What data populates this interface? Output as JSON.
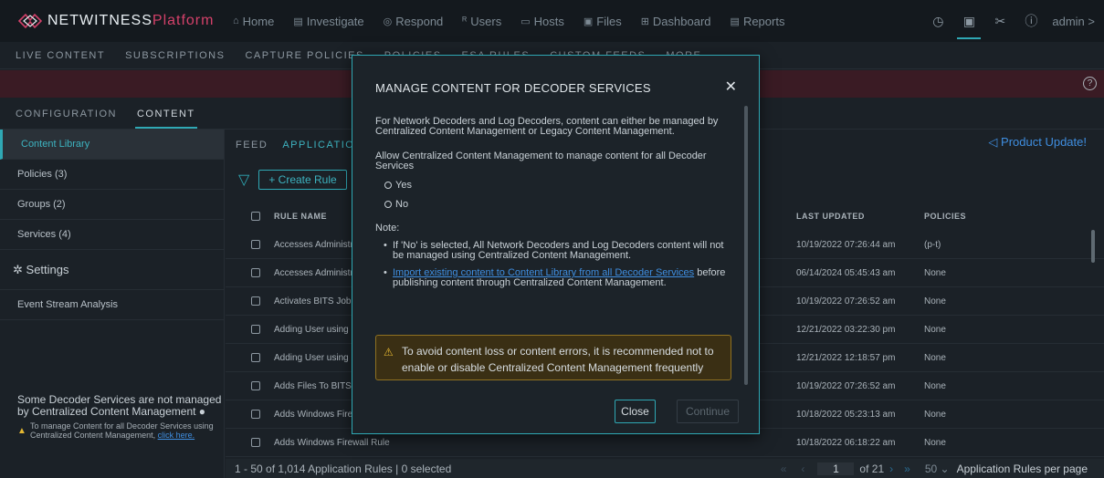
{
  "brand": {
    "name": "NETWITNESS",
    "product": "Platform"
  },
  "topnav": {
    "items": [
      {
        "icon": "home-icon",
        "glyph": "⌂",
        "label": "Home"
      },
      {
        "icon": "investigate-icon",
        "glyph": "▤",
        "label": "Investigate"
      },
      {
        "icon": "respond-icon",
        "glyph": "◎",
        "label": "Respond"
      },
      {
        "icon": "users-icon",
        "glyph": "ᴿ",
        "label": "Users"
      },
      {
        "icon": "hosts-icon",
        "glyph": "▭",
        "label": "Hosts"
      },
      {
        "icon": "files-icon",
        "glyph": "▣",
        "label": "Files"
      },
      {
        "icon": "dashboard-icon",
        "glyph": "⊞",
        "label": "Dashboard"
      },
      {
        "icon": "reports-icon",
        "glyph": "▤",
        "label": "Reports"
      }
    ],
    "user": "admin >"
  },
  "subnav": [
    "LIVE CONTENT",
    "SUBSCRIPTIONS",
    "CAPTURE POLICIES",
    "POLICIES",
    "ESA RULES",
    "CUSTOM FEEDS",
    "MORE ⌄"
  ],
  "config_tabs": [
    "CONFIGURATION",
    "CONTENT"
  ],
  "sidebar": {
    "items": [
      "Content Library",
      "Policies (3)",
      "Groups (2)",
      "Services (4)"
    ],
    "settings": "Settings",
    "event_stream": "Event Stream Analysis",
    "notice_title": "Some Decoder Services are not managed by Centralized Content Management",
    "notice_text": "To manage Content for all Decoder Services using Centralized Content Management,",
    "notice_link": "click here."
  },
  "main": {
    "tabs": [
      "FEED",
      "APPLICATION RULES"
    ],
    "product_update": "Product Update!",
    "create_label": "Create Rule",
    "columns": {
      "name": "RULE NAME",
      "updated": "LAST UPDATED",
      "policies": "POLICIES"
    },
    "rows": [
      {
        "name": "Accesses Administrative Share",
        "updated": "10/19/2022 07:26:44 am",
        "policies": "(p-t)"
      },
      {
        "name": "Accesses Administrative Share",
        "updated": "06/14/2024 05:45:43 am",
        "policies": "None"
      },
      {
        "name": "Activates BITS Job",
        "updated": "10/19/2022 07:26:52 am",
        "policies": "None"
      },
      {
        "name": "Adding User using Net",
        "updated": "12/21/2022 03:22:30 pm",
        "policies": "None"
      },
      {
        "name": "Adding User using Net",
        "updated": "12/21/2022 12:18:57 pm",
        "policies": "None"
      },
      {
        "name": "Adds Files To BITS Job",
        "updated": "10/19/2022 07:26:52 am",
        "policies": "None"
      },
      {
        "name": "Adds Windows Firewall Rule",
        "updated": "10/18/2022 05:23:13 am",
        "policies": "None"
      },
      {
        "name": "Adds Windows Firewall Rule",
        "updated": "10/18/2022 06:18:22 am",
        "policies": "None"
      }
    ],
    "footer": "1 - 50 of 1,014 Application Rules | 0 selected",
    "pager": {
      "page": "1",
      "of": "of 21",
      "per_page": "50",
      "per_page_label": "Application Rules per page"
    }
  },
  "modal": {
    "title": "MANAGE CONTENT FOR DECODER SERVICES",
    "intro": "For Network Decoders and Log Decoders, content can either be managed by Centralized Content Management or Legacy Content Management.",
    "question": "Allow Centralized Content Management to manage content for all Decoder Services",
    "options": [
      "Yes",
      "No"
    ],
    "note_label": "Note:",
    "note1": "If 'No' is selected, All Network Decoders and Log Decoders content will not be managed using Centralized Content Management.",
    "note2_link": "Import existing content to Content Library from all Decoder Services",
    "note2_rest": " before publishing content through Centralized Content Management.",
    "warning": "To avoid content loss or content errors, it is recommended not to enable or disable Centralized Content Management frequently",
    "close_label": "Close",
    "continue_label": "Continue"
  },
  "colors": {
    "accent": "#2fa8b4",
    "link": "#3f8ee0",
    "brand": "#d4416a",
    "warning": "#e5b832"
  }
}
